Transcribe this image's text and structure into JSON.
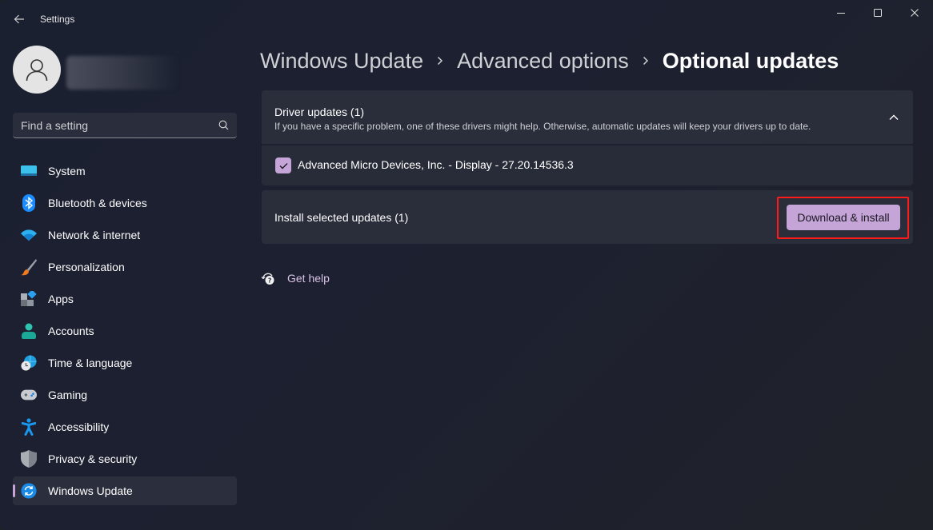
{
  "window": {
    "app_title": "Settings",
    "back_icon": "arrow-left-icon",
    "controls": {
      "minimize": "minimize-icon",
      "maximize": "maximize-icon",
      "close": "close-icon"
    }
  },
  "sidebar": {
    "profile": {
      "avatar_icon": "person-icon",
      "name": ""
    },
    "search": {
      "placeholder": "Find a setting",
      "value": "",
      "icon": "search-icon"
    },
    "items": [
      {
        "label": "System",
        "icon": "monitor-icon",
        "active": false
      },
      {
        "label": "Bluetooth & devices",
        "icon": "bluetooth-icon",
        "active": false
      },
      {
        "label": "Network & internet",
        "icon": "wifi-icon",
        "active": false
      },
      {
        "label": "Personalization",
        "icon": "brush-icon",
        "active": false
      },
      {
        "label": "Apps",
        "icon": "apps-icon",
        "active": false
      },
      {
        "label": "Accounts",
        "icon": "account-icon",
        "active": false
      },
      {
        "label": "Time & language",
        "icon": "globe-clock-icon",
        "active": false
      },
      {
        "label": "Gaming",
        "icon": "gamepad-icon",
        "active": false
      },
      {
        "label": "Accessibility",
        "icon": "accessibility-icon",
        "active": false
      },
      {
        "label": "Privacy & security",
        "icon": "shield-icon",
        "active": false
      },
      {
        "label": "Windows Update",
        "icon": "sync-icon",
        "active": true
      }
    ],
    "accent_color": "#c5a5d8"
  },
  "main": {
    "breadcrumb": [
      "Windows Update",
      "Advanced options",
      "Optional updates"
    ],
    "driver_updates": {
      "title": "Driver updates (1)",
      "description": "If you have a specific problem, one of these drivers might help. Otherwise, automatic updates will keep your drivers up to date.",
      "expanded": true,
      "items": [
        {
          "label": "Advanced Micro Devices, Inc. - Display - 27.20.14536.3",
          "checked": true
        }
      ]
    },
    "install": {
      "label": "Install selected updates (1)",
      "button_label": "Download & install",
      "highlight_color": "#ff1a1a"
    },
    "help": {
      "label": "Get help",
      "icon": "help-chat-icon"
    }
  }
}
